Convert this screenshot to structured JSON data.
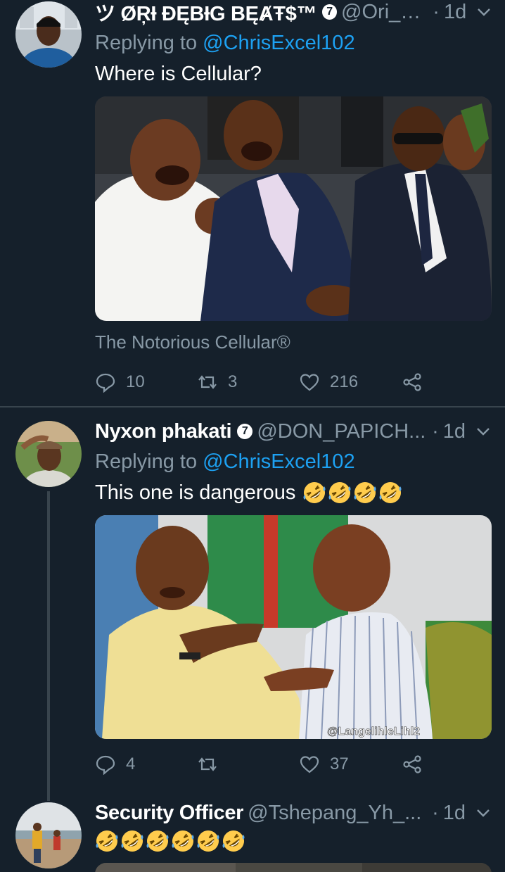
{
  "tweets": [
    {
      "name": "ツ ØŖƗ ĐĘBƗG BĘȺŦ$™",
      "badge": "7",
      "handle": "@Ori_D...",
      "dot": "·",
      "time": "1d",
      "reply_prefix": "Replying to ",
      "reply_mention": "@ChrisExcel102",
      "text": "Where is Cellular?",
      "caption": "The Notorious Cellular®",
      "stats": {
        "replies": "10",
        "retweets": "3",
        "likes": "216"
      }
    },
    {
      "name": "Nyxon phakati",
      "badge": "7",
      "handle": "@DON_PAPICH...",
      "dot": "·",
      "time": "1d",
      "reply_prefix": "Replying to ",
      "reply_mention": "@ChrisExcel102",
      "text": "This one is dangerous",
      "emoji_count": 4,
      "watermark": "@LangelihleLihl2",
      "stats": {
        "replies": "4",
        "retweets": "",
        "likes": "37"
      }
    },
    {
      "name": "Security Officer",
      "handle": "@Tshepang_Yh_...",
      "dot": "·",
      "time": "1d",
      "emoji_count": 6
    }
  ],
  "icons": {
    "reply": "comment-bubble-icon",
    "retweet": "retweet-arrows-icon",
    "like": "heart-outline-icon",
    "share": "share-nodes-icon",
    "menu": "chevron-down-icon"
  },
  "colors": {
    "background": "#15202b",
    "secondary_text": "#8899a6",
    "link": "#1da1f2",
    "divider": "#38444d"
  }
}
